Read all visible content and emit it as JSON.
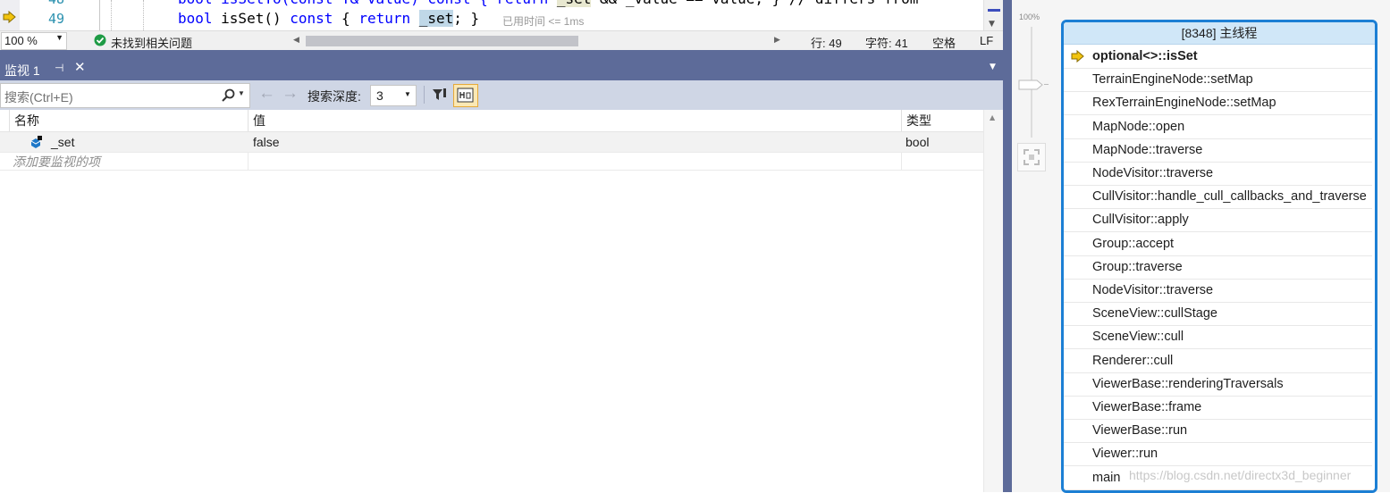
{
  "editor": {
    "lines": [
      {
        "num": "48",
        "code_prefix": "bool isSetTo(const T& value) const { return ",
        "code_hl": "_set",
        "code_mid": " && _value == value; } // differs from ",
        "code_tail": "..."
      },
      {
        "num": "49",
        "kw1": "bool",
        "fn": " isSet() ",
        "kw2": "const",
        "mid": " { ",
        "kw3": "return",
        "sp": " ",
        "hl": "_set",
        "end": "; }",
        "hint": "已用时间 <= 1ms"
      }
    ]
  },
  "status": {
    "zoom": "100 %",
    "issues": "未找到相关问题",
    "line": "行: 49",
    "char": "字符: 41",
    "space": "空格",
    "eol": "LF"
  },
  "watch": {
    "tab_label": "监视 1",
    "search_placeholder": "搜索(Ctrl+E)",
    "depth_label": "搜索深度:",
    "depth_value": "3",
    "columns": {
      "name": "名称",
      "value": "值",
      "type": "类型"
    },
    "rows": [
      {
        "name": "_set",
        "value": "false",
        "type": "bool"
      }
    ],
    "add_item": "添加要监视的项"
  },
  "zoom_slider": {
    "label": "100%"
  },
  "callstack": {
    "title": "[8348] 主线程",
    "frames": [
      "optional<>::isSet",
      "TerrainEngineNode::setMap",
      "RexTerrainEngineNode::setMap",
      "MapNode::open",
      "MapNode::traverse",
      "NodeVisitor::traverse",
      "CullVisitor::handle_cull_callbacks_and_traverse",
      "CullVisitor::apply",
      "Group::accept",
      "Group::traverse",
      "NodeVisitor::traverse",
      "SceneView::cullStage",
      "SceneView::cull",
      "Renderer::cull",
      "ViewerBase::renderingTraversals",
      "ViewerBase::frame",
      "ViewerBase::run",
      "Viewer::run",
      "main"
    ]
  },
  "watermark": "https://blog.csdn.net/directx3d_beginner",
  "colors": {
    "accent": "#1c7fd4",
    "toolwindow_title": "#5d6b99",
    "current_frame_arrow": "#f2c40f"
  }
}
